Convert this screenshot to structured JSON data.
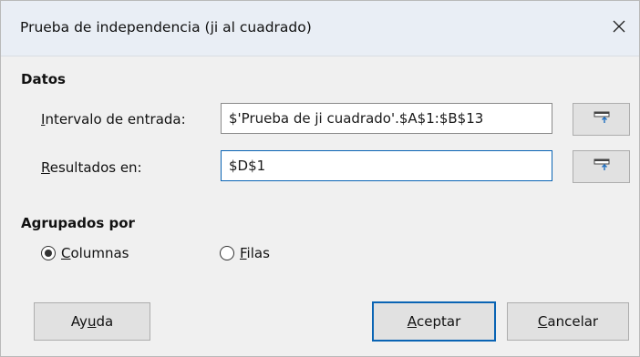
{
  "dialog": {
    "title": "Prueba de independencia (ji al cuadrado)"
  },
  "data_section": {
    "title": "Datos",
    "input_range": {
      "label_prefix": "",
      "label_mnemonic": "I",
      "label_suffix": "ntervalo de entrada:",
      "value": "$'Prueba de ji cuadrado'.$A$1:$B$13"
    },
    "results_to": {
      "label_prefix": "",
      "label_mnemonic": "R",
      "label_suffix": "esultados en:",
      "value": "$D$1"
    }
  },
  "grouped_section": {
    "title": "Agrupados por",
    "columns": {
      "label_prefix": "",
      "label_mnemonic": "C",
      "label_suffix": "olumnas",
      "selected": true
    },
    "rows": {
      "label_prefix": "",
      "label_mnemonic": "F",
      "label_suffix": "ilas",
      "selected": false
    }
  },
  "buttons": {
    "help": {
      "prefix": "Ay",
      "mnemonic": "u",
      "suffix": "da"
    },
    "ok": {
      "prefix": "",
      "mnemonic": "A",
      "suffix": "ceptar"
    },
    "cancel": {
      "prefix": "",
      "mnemonic": "C",
      "suffix": "ancelar"
    }
  },
  "icons": {
    "close": "close-icon",
    "shrink": "shrink-icon"
  },
  "colors": {
    "title_bar": "#e9eef5",
    "focus_border": "#0a64b4",
    "icon_arrow": "#1f6fc1"
  }
}
